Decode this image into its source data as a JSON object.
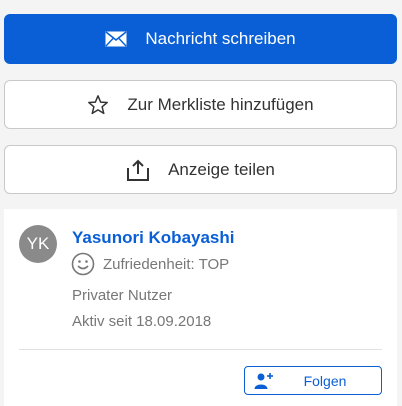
{
  "actions": {
    "message_label": "Nachricht schreiben",
    "watchlist_label": "Zur Merkliste hinzufügen",
    "share_label": "Anzeige teilen"
  },
  "seller": {
    "initials": "YK",
    "name": "Yasunori Kobayashi",
    "satisfaction": "Zufriedenheit: TOP",
    "type": "Privater Nutzer",
    "active_since": "Aktiv seit 18.09.2018",
    "follow_label": "Folgen"
  },
  "colors": {
    "accent": "#0a5fd6",
    "background": "#f4f4f4"
  },
  "icons": {
    "message": "envelope-icon",
    "watchlist": "star-icon",
    "share": "share-icon",
    "satisfaction": "smiley-icon",
    "follow": "person-plus-icon"
  }
}
